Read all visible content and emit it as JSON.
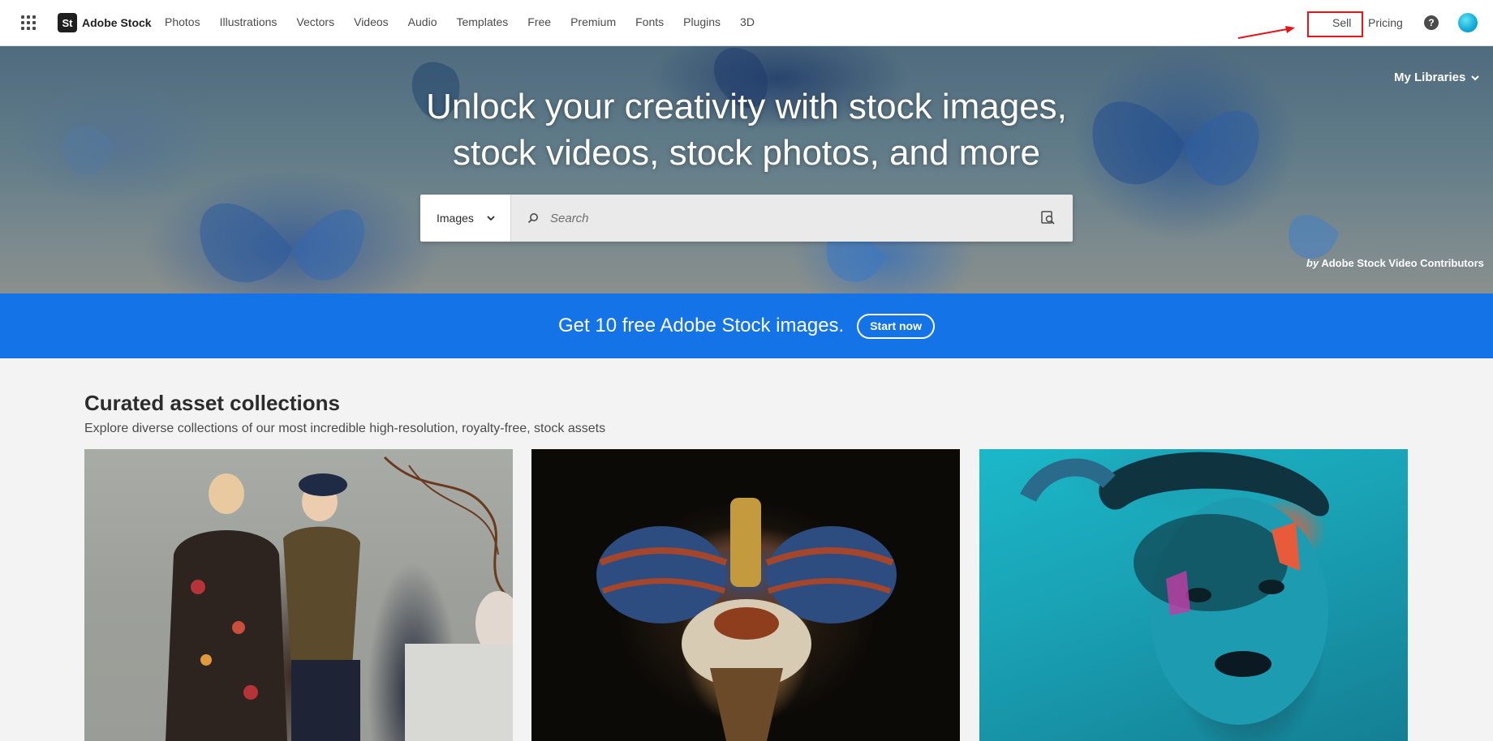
{
  "header": {
    "brand_logo": "St",
    "brand_name": "Adobe Stock",
    "nav": [
      "Photos",
      "Illustrations",
      "Vectors",
      "Videos",
      "Audio",
      "Templates",
      "Free",
      "Premium",
      "Fonts",
      "Plugins",
      "3D"
    ],
    "sell_label": "Sell",
    "pricing_label": "Pricing",
    "help_glyph": "?",
    "icons": {
      "apps": "app-grid-icon",
      "help": "help-icon",
      "avatar": "avatar-icon"
    }
  },
  "hero": {
    "title_line1": "Unlock your creativity with stock images,",
    "title_line2": "stock videos, stock photos, and more",
    "my_libraries_label": "My Libraries",
    "credit_by": "by",
    "credit_name": "Adobe Stock Video Contributors",
    "search": {
      "type_selected": "Images",
      "placeholder": "Search"
    }
  },
  "promo": {
    "text": "Get 10 free Adobe Stock images.",
    "button_label": "Start now",
    "background_color": "#1473e6"
  },
  "collections": {
    "title": "Curated asset collections",
    "subtitle": "Explore diverse collections of our most incredible high-resolution, royalty-free, stock assets"
  },
  "annotation": {
    "highlight_color": "#e8141a"
  }
}
